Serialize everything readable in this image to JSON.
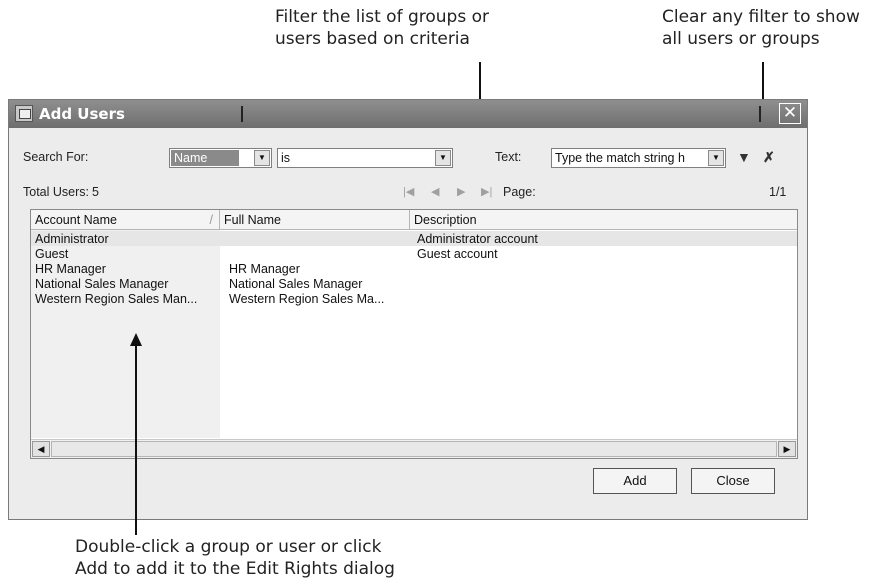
{
  "callouts": {
    "filter_line1": "Filter the list of groups or",
    "filter_line2": "users based on criteria",
    "clear_line1": "Clear any filter to show",
    "clear_line2": "all users or groups",
    "dbl_line1": "Double-click a group or user or click",
    "dbl_line2": "Add to add it to the Edit Rights dialog"
  },
  "window": {
    "title": "Add Users",
    "close_glyph": "✕"
  },
  "search": {
    "label": "Search For:",
    "field_value": "Name",
    "operator_value": "is",
    "text_label": "Text:",
    "text_value": "Type the match string h"
  },
  "total": {
    "label": "Total Users:",
    "count": "5"
  },
  "pager": {
    "page_label": "Page:",
    "page_value": "1/1",
    "first": "|◀",
    "prev": "◀",
    "next": "▶",
    "last": "▶|"
  },
  "icons": {
    "filter": "filter-icon",
    "clear_filter": "clear-filter-icon"
  },
  "list": {
    "columns": [
      "Account Name",
      "Full Name",
      "Description"
    ],
    "sort_indicator": "/",
    "rows": [
      {
        "account": "Administrator",
        "full": "",
        "desc": "Administrator account"
      },
      {
        "account": "Guest",
        "full": "",
        "desc": "Guest account"
      },
      {
        "account": "HR Manager",
        "full": "HR Manager",
        "desc": ""
      },
      {
        "account": "National Sales Manager",
        "full": "National Sales Manager",
        "desc": ""
      },
      {
        "account": "Western Region Sales Man...",
        "full": "Western Region Sales Ma...",
        "desc": ""
      }
    ]
  },
  "buttons": {
    "add": "Add",
    "close": "Close"
  }
}
